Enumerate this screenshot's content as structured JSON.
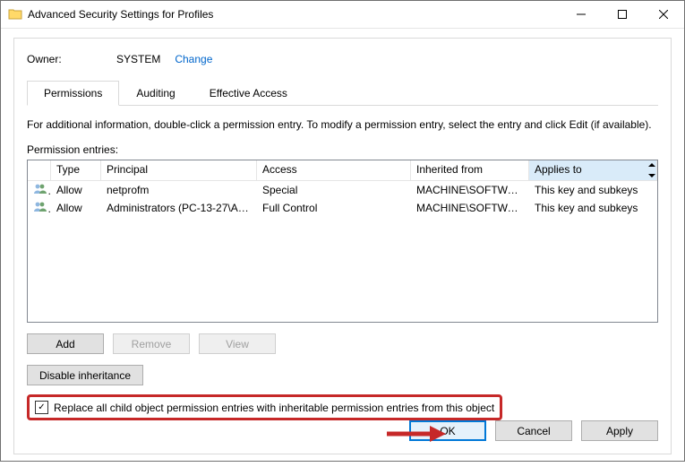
{
  "window": {
    "title": "Advanced Security Settings for Profiles"
  },
  "owner": {
    "label": "Owner:",
    "value": "SYSTEM",
    "change": "Change"
  },
  "tabs": {
    "t1": "Permissions",
    "t2": "Auditing",
    "t3": "Effective Access"
  },
  "info": "For additional information, double-click a permission entry. To modify a permission entry, select the entry and click Edit (if available).",
  "entries_label": "Permission entries:",
  "columns": {
    "type": "Type",
    "principal": "Principal",
    "access": "Access",
    "inherited": "Inherited from",
    "applies": "Applies to"
  },
  "rows": [
    {
      "type": "Allow",
      "principal": "netprofm",
      "access": "Special",
      "inherited": "MACHINE\\SOFTWARE...",
      "applies": "This key and subkeys"
    },
    {
      "type": "Allow",
      "principal": "Administrators (PC-13-27\\Ad...",
      "access": "Full Control",
      "inherited": "MACHINE\\SOFTWARE...",
      "applies": "This key and subkeys"
    }
  ],
  "buttons": {
    "add": "Add",
    "remove": "Remove",
    "view": "View",
    "disable": "Disable inheritance",
    "ok": "OK",
    "cancel": "Cancel",
    "apply": "Apply"
  },
  "checkbox": {
    "label": "Replace all child object permission entries with inheritable permission entries from this object",
    "checked": true
  },
  "colors": {
    "link": "#0066cc",
    "highlight_border": "#c62828",
    "focus": "#0078d7"
  }
}
